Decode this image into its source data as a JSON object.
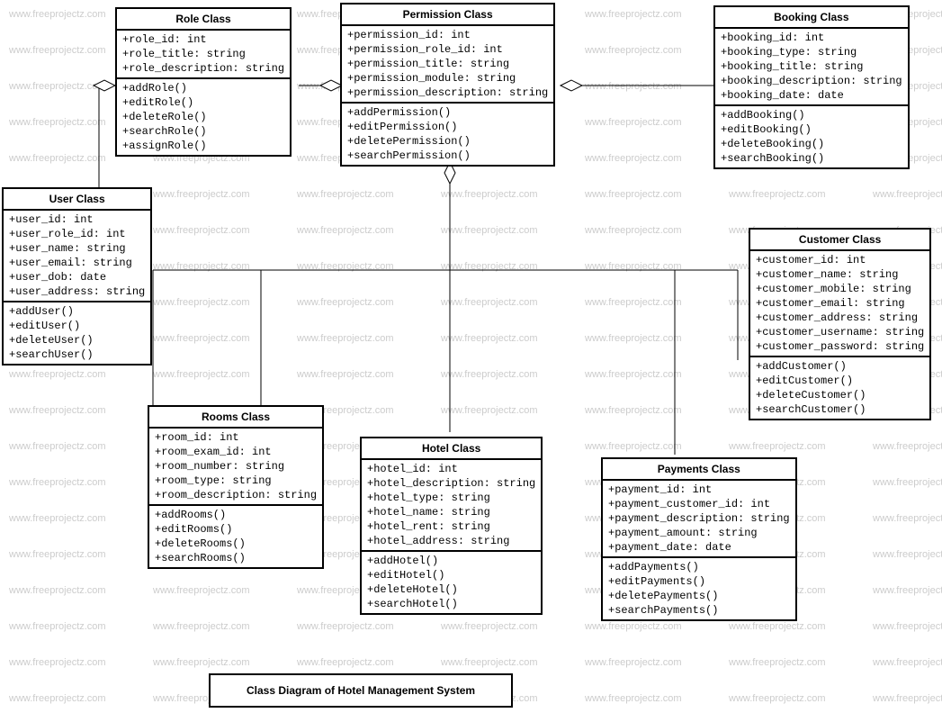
{
  "title": "Class Diagram of Hotel Management System",
  "watermark": "www.freeprojectz.com",
  "classes": {
    "role": {
      "name": "Role Class",
      "attrs": [
        "+role_id: int",
        "+role_title: string",
        "+role_description: string"
      ],
      "meths": [
        "+addRole()",
        "+editRole()",
        "+deleteRole()",
        "+searchRole()",
        "+assignRole()"
      ]
    },
    "permission": {
      "name": "Permission Class",
      "attrs": [
        "+permission_id: int",
        "+permission_role_id: int",
        "+permission_title: string",
        "+permission_module: string",
        "+permission_description: string"
      ],
      "meths": [
        "+addPermission()",
        "+editPermission()",
        "+deletePermission()",
        "+searchPermission()"
      ]
    },
    "booking": {
      "name": "Booking Class",
      "attrs": [
        "+booking_id: int",
        "+booking_type: string",
        "+booking_title: string",
        "+booking_description: string",
        "+booking_date: date"
      ],
      "meths": [
        "+addBooking()",
        "+editBooking()",
        "+deleteBooking()",
        "+searchBooking()"
      ]
    },
    "user": {
      "name": "User Class",
      "attrs": [
        "+user_id: int",
        "+user_role_id: int",
        "+user_name: string",
        "+user_email: string",
        "+user_dob: date",
        "+user_address: string"
      ],
      "meths": [
        "+addUser()",
        "+editUser()",
        "+deleteUser()",
        "+searchUser()"
      ]
    },
    "customer": {
      "name": "Customer Class",
      "attrs": [
        "+customer_id: int",
        "+customer_name: string",
        "+customer_mobile: string",
        "+customer_email: string",
        "+customer_address: string",
        "+customer_username: string",
        "+customer_password: string"
      ],
      "meths": [
        "+addCustomer()",
        "+editCustomer()",
        "+deleteCustomer()",
        "+searchCustomer()"
      ]
    },
    "rooms": {
      "name": "Rooms Class",
      "attrs": [
        "+room_id: int",
        "+room_exam_id: int",
        "+room_number: string",
        "+room_type: string",
        "+room_description: string"
      ],
      "meths": [
        "+addRooms()",
        "+editRooms()",
        "+deleteRooms()",
        "+searchRooms()"
      ]
    },
    "hotel": {
      "name": "Hotel Class",
      "attrs": [
        "+hotel_id: int",
        "+hotel_description: string",
        "+hotel_type: string",
        "+hotel_name: string",
        "+hotel_rent: string",
        "+hotel_address: string"
      ],
      "meths": [
        "+addHotel()",
        "+editHotel()",
        "+deleteHotel()",
        "+searchHotel()"
      ]
    },
    "payments": {
      "name": "Payments Class",
      "attrs": [
        "+payment_id: int",
        "+payment_customer_id: int",
        "+payment_description: string",
        "+payment_amount: string",
        "+payment_date: date"
      ],
      "meths": [
        "+addPayments()",
        "+editPayments()",
        "+deletePayments()",
        "+searchPayments()"
      ]
    }
  }
}
